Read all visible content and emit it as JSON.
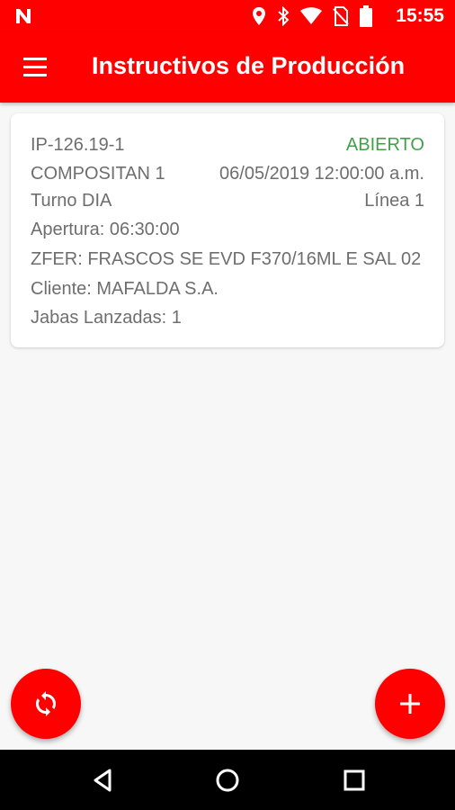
{
  "status_bar": {
    "time": "15:55",
    "icons": [
      "n-logo-icon",
      "location-icon",
      "bluetooth-icon",
      "wifi-icon",
      "no-sim-icon",
      "battery-icon"
    ]
  },
  "app_bar": {
    "title": "Instructivos de Producción",
    "menu_icon": "hamburger-menu-icon"
  },
  "cards": [
    {
      "code": "IP-126.19-1",
      "status": "ABIERTO",
      "product": "COMPOSITAN 1",
      "datetime": "06/05/2019 12:00:00 a.m.",
      "shift": "Turno DIA",
      "line": "Línea 1",
      "opening": "Apertura:  06:30:00",
      "zfer": "ZFER: FRASCOS SE EVD F370/16ML E SAL 02",
      "client": "Cliente: MAFALDA S.A.",
      "crates": "Jabas Lanzadas: 1"
    }
  ],
  "fabs": {
    "sync_icon": "sync-icon",
    "add_icon": "add-icon"
  },
  "nav_bar": {
    "icons": [
      "back-icon",
      "home-icon",
      "recents-icon"
    ]
  },
  "colors": {
    "primary": "#ff0000",
    "status_open": "#43a047",
    "card_text": "#6e6e6e",
    "background": "#f7f7f7"
  }
}
